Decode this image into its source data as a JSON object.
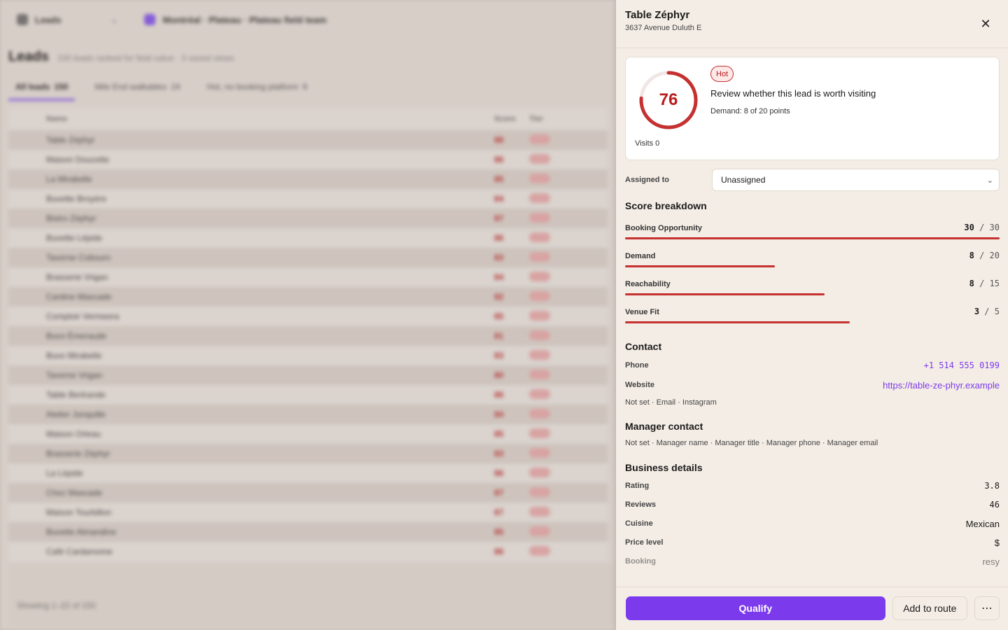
{
  "background": {
    "top_nav": {
      "section": "Leads",
      "workspace": "Montréal · Plateau · Plateau field team"
    },
    "title": "Leads",
    "subtitle": "150 leads ranked for field value · 3 saved views",
    "tabs": [
      {
        "label": "All leads",
        "count": "150"
      },
      {
        "label": "Mile End walkables",
        "count": "24"
      },
      {
        "label": "Hot, no booking platform",
        "count": "9"
      }
    ],
    "columns": {
      "name": "Name",
      "score": "Score",
      "tier": "Tier"
    },
    "rows": [
      {
        "name": "Table Zéphyr",
        "score": "88"
      },
      {
        "name": "Maison Doucette",
        "score": "86"
      },
      {
        "name": "La Mirabelle",
        "score": "85"
      },
      {
        "name": "Buvette Broyère",
        "score": "84"
      },
      {
        "name": "Bistro Zéphyr",
        "score": "87"
      },
      {
        "name": "Buvette Lépide",
        "score": "86"
      },
      {
        "name": "Taverne Cobourn",
        "score": "83"
      },
      {
        "name": "Brasserie Vrigan",
        "score": "84"
      },
      {
        "name": "Cantine Mascade",
        "score": "82"
      },
      {
        "name": "Comptoir Vermeera",
        "score": "85"
      },
      {
        "name": "Buvo Émeraude",
        "score": "81"
      },
      {
        "name": "Buvo Mirabelle",
        "score": "83"
      },
      {
        "name": "Taverne Vrigan",
        "score": "80"
      },
      {
        "name": "Table Bertrande",
        "score": "86"
      },
      {
        "name": "Atelier Jonquille",
        "score": "84"
      },
      {
        "name": "Maison Orleau",
        "score": "85"
      },
      {
        "name": "Brasserie Zéphyr",
        "score": "83"
      },
      {
        "name": "La Lépide",
        "score": "86"
      },
      {
        "name": "Chez Mascade",
        "score": "87"
      },
      {
        "name": "Maison Tourbillon",
        "score": "87"
      },
      {
        "name": "Buvette Almandine",
        "score": "85"
      },
      {
        "name": "Café Cardamome",
        "score": "86"
      }
    ],
    "footer_text": "Showing 1–22 of 150"
  },
  "panel": {
    "name": "Table Zéphyr",
    "address": "3637 Avenue Duluth E",
    "score": {
      "value": "76",
      "fraction": 0.76,
      "tier_badge": "Hot",
      "verdict": "Review whether this lead is worth visiting",
      "demand_note": "Demand: 8 of 20 points",
      "visits": "Visits 0"
    },
    "assigned": {
      "label": "Assigned to",
      "value": "Unassigned"
    },
    "score_breakdown": {
      "title": "Score breakdown",
      "items": [
        {
          "label": "Booking Opportunity",
          "value": "30",
          "max": "30",
          "fraction": 1.0
        },
        {
          "label": "Demand",
          "value": "8",
          "max": "20",
          "fraction": 0.4
        },
        {
          "label": "Reachability",
          "value": "8",
          "max": "15",
          "fraction": 0.533
        },
        {
          "label": "Venue Fit",
          "value": "3",
          "max": "5",
          "fraction": 0.6
        }
      ]
    },
    "contact": {
      "title": "Contact",
      "phone_label": "Phone",
      "phone": "+1 514 555 0199",
      "website_label": "Website",
      "website": "https://table-ze-phyr.example",
      "missing": "Not set · Email · Instagram"
    },
    "manager": {
      "title": "Manager contact",
      "missing": "Not set · Manager name · Manager title · Manager phone · Manager email"
    },
    "business": {
      "title": "Business details",
      "rows": [
        {
          "label": "Rating",
          "value": "3.8"
        },
        {
          "label": "Reviews",
          "value": "46"
        },
        {
          "label": "Cuisine",
          "value": "Mexican"
        },
        {
          "label": "Price level",
          "value": "$"
        },
        {
          "label": "Booking",
          "value": "resy"
        }
      ]
    },
    "actions": {
      "qualify": "Qualify",
      "add_route": "Add to route",
      "more": "⋯"
    }
  },
  "colors": {
    "accent": "#7c3aed",
    "hot": "#c53030",
    "panel_bg": "#f4ede5"
  }
}
